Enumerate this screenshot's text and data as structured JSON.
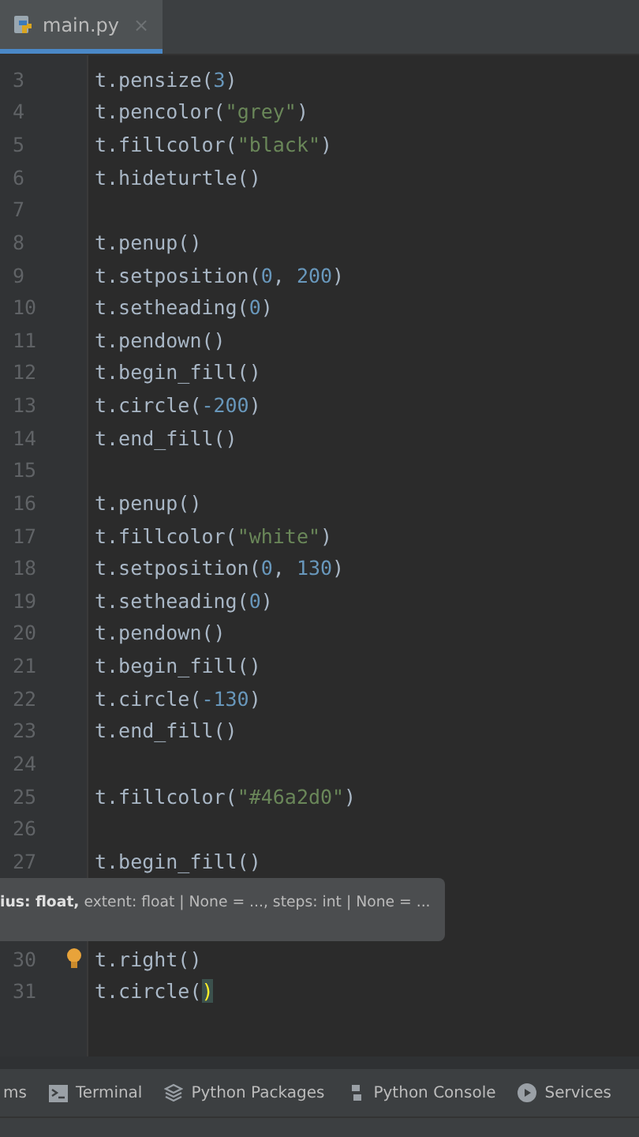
{
  "tabs": [
    {
      "label": "main.py",
      "close": "×",
      "selected": true
    }
  ],
  "lines": [
    {
      "number": "3",
      "code": [
        {
          "text": "t.pensize(",
          "kind": "plain"
        },
        {
          "text": "3",
          "kind": "number"
        },
        {
          "text": ")",
          "kind": "plain"
        }
      ]
    },
    {
      "number": "4",
      "code": [
        {
          "text": "t.pencolor(",
          "kind": "plain"
        },
        {
          "text": "\"grey\"",
          "kind": "string"
        },
        {
          "text": ")",
          "kind": "plain"
        }
      ]
    },
    {
      "number": "5",
      "code": [
        {
          "text": "t.fillcolor(",
          "kind": "plain"
        },
        {
          "text": "\"black\"",
          "kind": "string"
        },
        {
          "text": ")",
          "kind": "plain"
        }
      ]
    },
    {
      "number": "6",
      "code": [
        {
          "text": "t.hideturtle()",
          "kind": "plain"
        }
      ]
    },
    {
      "number": "7"
    },
    {
      "number": "8",
      "code": [
        {
          "text": "t.penup()",
          "kind": "plain"
        }
      ]
    },
    {
      "number": "9",
      "code": [
        {
          "text": "t.setposition(",
          "kind": "plain"
        },
        {
          "text": "0",
          "kind": "number"
        },
        {
          "text": ", ",
          "kind": "plain"
        },
        {
          "text": "200",
          "kind": "number"
        },
        {
          "text": ")",
          "kind": "plain"
        }
      ]
    },
    {
      "number": "10",
      "code": [
        {
          "text": "t.setheading(",
          "kind": "plain"
        },
        {
          "text": "0",
          "kind": "number"
        },
        {
          "text": ")",
          "kind": "plain"
        }
      ]
    },
    {
      "number": "11",
      "code": [
        {
          "text": "t.pendown()",
          "kind": "plain"
        }
      ]
    },
    {
      "number": "12",
      "code": [
        {
          "text": "t.begin_fill()",
          "kind": "plain"
        }
      ]
    },
    {
      "number": "13",
      "code": [
        {
          "text": "t.circle(",
          "kind": "plain"
        },
        {
          "text": "-200",
          "kind": "number"
        },
        {
          "text": ")",
          "kind": "plain"
        }
      ]
    },
    {
      "number": "14",
      "code": [
        {
          "text": "t.end_fill()",
          "kind": "plain"
        }
      ]
    },
    {
      "number": "15"
    },
    {
      "number": "16",
      "code": [
        {
          "text": "t.penup()",
          "kind": "plain"
        }
      ]
    },
    {
      "number": "17",
      "code": [
        {
          "text": "t.fillcolor(",
          "kind": "plain"
        },
        {
          "text": "\"white\"",
          "kind": "string"
        },
        {
          "text": ")",
          "kind": "plain"
        }
      ]
    },
    {
      "number": "18",
      "code": [
        {
          "text": "t.setposition(",
          "kind": "plain"
        },
        {
          "text": "0",
          "kind": "number"
        },
        {
          "text": ", ",
          "kind": "plain"
        },
        {
          "text": "130",
          "kind": "number"
        },
        {
          "text": ")",
          "kind": "plain"
        }
      ]
    },
    {
      "number": "19",
      "code": [
        {
          "text": "t.setheading(",
          "kind": "plain"
        },
        {
          "text": "0",
          "kind": "number"
        },
        {
          "text": ")",
          "kind": "plain"
        }
      ]
    },
    {
      "number": "20",
      "code": [
        {
          "text": "t.pendown()",
          "kind": "plain"
        }
      ]
    },
    {
      "number": "21",
      "code": [
        {
          "text": "t.begin_fill()",
          "kind": "plain"
        }
      ]
    },
    {
      "number": "22",
      "code": [
        {
          "text": "t.circle(",
          "kind": "plain"
        },
        {
          "text": "-130",
          "kind": "number"
        },
        {
          "text": ")",
          "kind": "plain"
        }
      ]
    },
    {
      "number": "23",
      "code": [
        {
          "text": "t.end_fill()",
          "kind": "plain"
        }
      ]
    },
    {
      "number": "24"
    },
    {
      "number": "25",
      "code": [
        {
          "text": "t.fillcolor(",
          "kind": "plain"
        },
        {
          "text": "\"#46a2d0\"",
          "kind": "string"
        },
        {
          "text": ")",
          "kind": "plain"
        }
      ]
    },
    {
      "number": "26"
    },
    {
      "number": "27",
      "code": [
        {
          "text": "t.begin_fill()",
          "kind": "plain"
        }
      ]
    }
  ],
  "tooltip": "**ius: float,** extent: float | None = ..., steps: int | None = ...",
  "after_lines": [
    {
      "number": "30",
      "hint": true,
      "code": [
        {
          "text": "t.right()",
          "kind": "plain"
        }
      ]
    },
    {
      "number": "31",
      "code": [
        {
          "text": "t.circle(",
          "kind": "plain"
        },
        {
          "text": ")",
          "kind": "brace"
        }
      ]
    }
  ],
  "tool_windows": [
    {
      "label": "ms"
    },
    {
      "label": "Terminal"
    },
    {
      "label": "Python Packages"
    },
    {
      "label": "Python Console"
    },
    {
      "label": "Services"
    }
  ]
}
